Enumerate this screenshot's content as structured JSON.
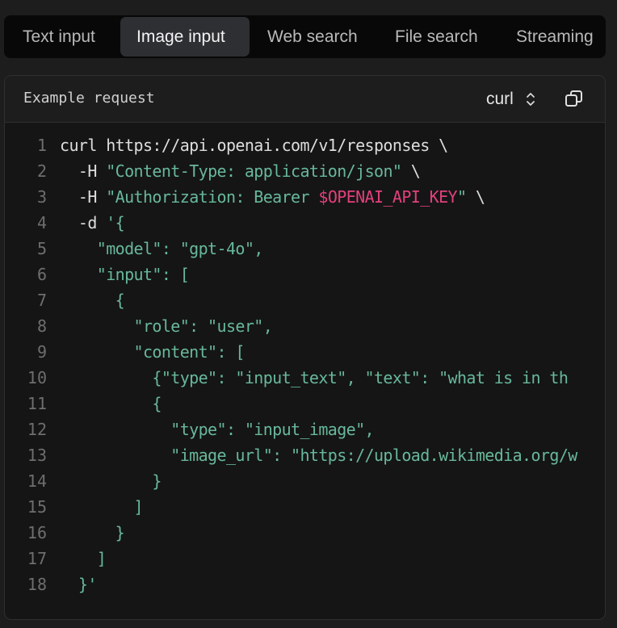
{
  "tabs": [
    {
      "label": "Text input",
      "active": false
    },
    {
      "label": "Image input",
      "active": true
    },
    {
      "label": "Web search",
      "active": false
    },
    {
      "label": "File search",
      "active": false
    },
    {
      "label": "Streaming",
      "active": false
    }
  ],
  "panel": {
    "title": "Example request",
    "language": "curl",
    "copy_icon": "copy-icon",
    "select_icon": "chevron-up-down-icon"
  },
  "colors": {
    "string": "#68b89a",
    "variable": "#e2407c",
    "plain": "#dddddd",
    "line_number": "#6e6e6e"
  },
  "code": {
    "lines": [
      {
        "n": "1",
        "tokens": [
          {
            "t": "curl https://api.openai.com/v1/responses \\",
            "k": "plain"
          }
        ]
      },
      {
        "n": "2",
        "tokens": [
          {
            "t": "  -H ",
            "k": "plain"
          },
          {
            "t": "\"Content-Type: application/json\"",
            "k": "str"
          },
          {
            "t": " \\",
            "k": "plain"
          }
        ]
      },
      {
        "n": "3",
        "tokens": [
          {
            "t": "  -H ",
            "k": "plain"
          },
          {
            "t": "\"Authorization: Bearer ",
            "k": "str"
          },
          {
            "t": "$OPENAI_API_KEY",
            "k": "var"
          },
          {
            "t": "\"",
            "k": "str"
          },
          {
            "t": " \\",
            "k": "plain"
          }
        ]
      },
      {
        "n": "4",
        "tokens": [
          {
            "t": "  -d ",
            "k": "plain"
          },
          {
            "t": "'{",
            "k": "str"
          }
        ]
      },
      {
        "n": "5",
        "tokens": [
          {
            "t": "    \"model\": \"gpt-4o\",",
            "k": "str"
          }
        ]
      },
      {
        "n": "6",
        "tokens": [
          {
            "t": "    \"input\": [",
            "k": "str"
          }
        ]
      },
      {
        "n": "7",
        "tokens": [
          {
            "t": "      {",
            "k": "str"
          }
        ]
      },
      {
        "n": "8",
        "tokens": [
          {
            "t": "        \"role\": \"user\",",
            "k": "str"
          }
        ]
      },
      {
        "n": "9",
        "tokens": [
          {
            "t": "        \"content\": [",
            "k": "str"
          }
        ]
      },
      {
        "n": "10",
        "tokens": [
          {
            "t": "          {\"type\": \"input_text\", \"text\": \"what is in th",
            "k": "str"
          }
        ]
      },
      {
        "n": "11",
        "tokens": [
          {
            "t": "          {",
            "k": "str"
          }
        ]
      },
      {
        "n": "12",
        "tokens": [
          {
            "t": "            \"type\": \"input_image\",",
            "k": "str"
          }
        ]
      },
      {
        "n": "13",
        "tokens": [
          {
            "t": "            \"image_url\": \"https://upload.wikimedia.org/w",
            "k": "str"
          }
        ]
      },
      {
        "n": "14",
        "tokens": [
          {
            "t": "          }",
            "k": "str"
          }
        ]
      },
      {
        "n": "15",
        "tokens": [
          {
            "t": "        ]",
            "k": "str"
          }
        ]
      },
      {
        "n": "16",
        "tokens": [
          {
            "t": "      }",
            "k": "str"
          }
        ]
      },
      {
        "n": "17",
        "tokens": [
          {
            "t": "    ]",
            "k": "str"
          }
        ]
      },
      {
        "n": "18",
        "tokens": [
          {
            "t": "  }'",
            "k": "str"
          }
        ]
      }
    ]
  }
}
